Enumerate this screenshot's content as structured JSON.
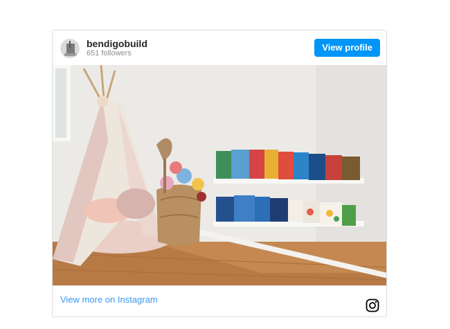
{
  "profile": {
    "username": "bendigobuild",
    "followers": "651 followers",
    "avatar_icon": "profile-avatar"
  },
  "actions": {
    "view_profile_label": "View profile",
    "view_more_label": "View more on Instagram"
  },
  "icons": {
    "footer_icon": "instagram-icon"
  },
  "colors": {
    "accent": "#0095f6",
    "link": "#3897f0",
    "username": "#262626",
    "muted": "#8e8e8e",
    "border": "#dbdbdb"
  }
}
